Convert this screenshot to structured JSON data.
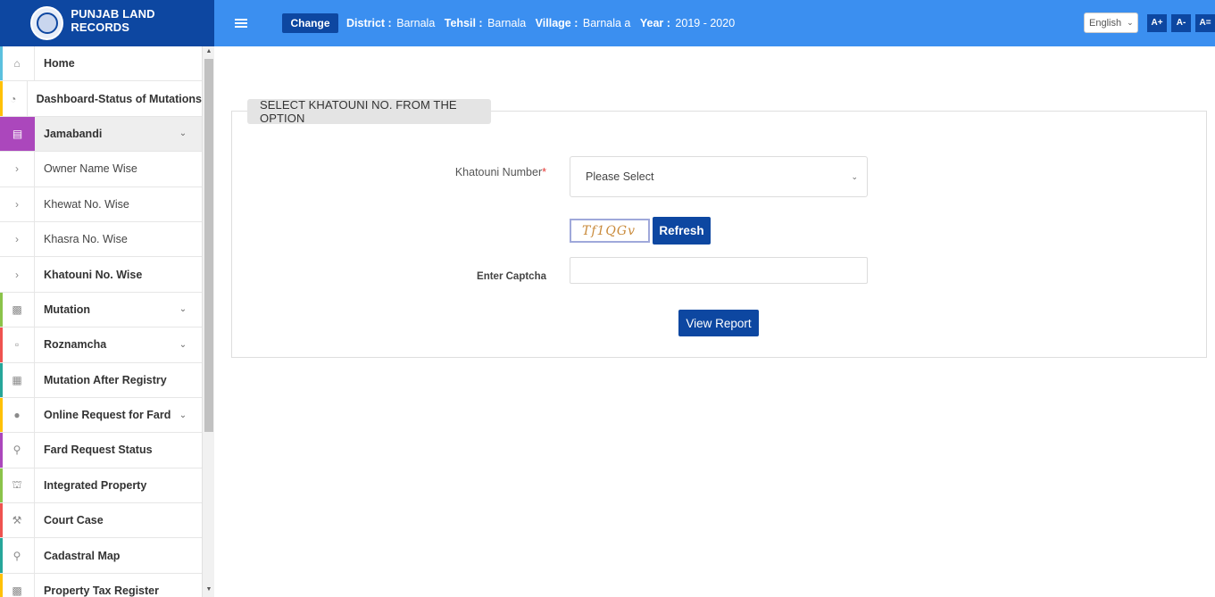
{
  "brand": {
    "title": "PUNJAB LAND RECORDS"
  },
  "topbar": {
    "change_label": "Change",
    "district_label": "District :",
    "district_value": "Barnala",
    "tehsil_label": "Tehsil :",
    "tehsil_value": "Barnala",
    "village_label": "Village :",
    "village_value": "Barnala a",
    "year_label": "Year :",
    "year_value": "2019 - 2020",
    "language": "English",
    "font_increase": "A+",
    "font_decrease": "A-",
    "font_reset": "A="
  },
  "sidebar": {
    "items": [
      {
        "label": "Home",
        "icon": "home-icon",
        "color": "#5bc0de"
      },
      {
        "label": "Dashboard-Status of Mutations",
        "icon": "dashboard-icon",
        "color": "#ffc107"
      },
      {
        "label": "Jamabandi",
        "icon": "jamabandi-icon",
        "color": "#ab47bc"
      },
      {
        "label": "Owner Name Wise",
        "icon": "chevron-right-icon"
      },
      {
        "label": "Khewat No. Wise",
        "icon": "chevron-right-icon"
      },
      {
        "label": "Khasra No. Wise",
        "icon": "chevron-right-icon"
      },
      {
        "label": "Khatouni No. Wise",
        "icon": "chevron-right-icon"
      },
      {
        "label": "Mutation",
        "icon": "file-icon",
        "color": "#8bc34a"
      },
      {
        "label": "Roznamcha",
        "icon": "book-icon",
        "color": "#ef5350"
      },
      {
        "label": "Mutation After Registry",
        "icon": "briefcase-icon",
        "color": "#26a69a"
      },
      {
        "label": "Online Request for Fard",
        "icon": "drop-icon",
        "color": "#ffc107"
      },
      {
        "label": "Fard Request Status",
        "icon": "search-icon",
        "color": "#ab47bc"
      },
      {
        "label": "Integrated Property",
        "icon": "bank-icon",
        "color": "#8bc34a"
      },
      {
        "label": "Court Case",
        "icon": "gavel-icon",
        "color": "#ef5350"
      },
      {
        "label": "Cadastral Map",
        "icon": "map-pin-icon",
        "color": "#26a69a"
      },
      {
        "label": "Property Tax Register",
        "icon": "register-icon",
        "color": "#ffc107"
      }
    ]
  },
  "main": {
    "section_title": "SELECT KHATOUNI NO. FROM THE OPTION",
    "khatouni_label": "Khatouni Number",
    "required_mark": "*",
    "khatouni_selected": "Please Select",
    "captcha_text": "Tf1QGv",
    "refresh_label": "Refresh",
    "captcha_label": "Enter Captcha",
    "captcha_value": "",
    "view_report_label": "View Report"
  },
  "colors": {
    "brand_blue": "#0d47a1",
    "topbar_blue": "#3b8ff0",
    "active_purple": "#ab47bc"
  }
}
